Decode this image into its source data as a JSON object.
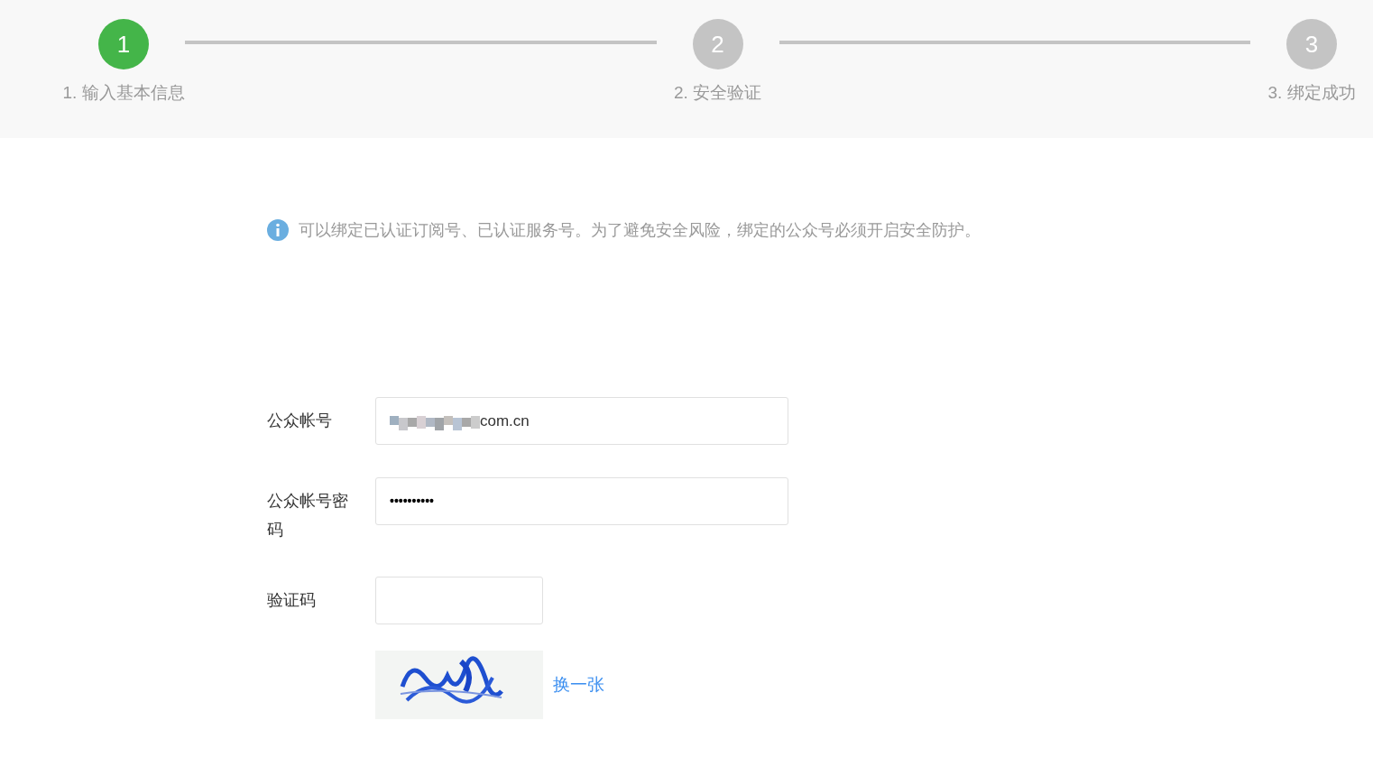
{
  "steps": [
    {
      "number": "1",
      "label": "1. 输入基本信息",
      "active": true
    },
    {
      "number": "2",
      "label": "2. 安全验证",
      "active": false
    },
    {
      "number": "3",
      "label": "3. 绑定成功",
      "active": false
    }
  ],
  "notice": "可以绑定已认证订阅号、已认证服务号。为了避免安全风险，绑定的公众号必须开启安全防护。",
  "form": {
    "fields": [
      {
        "kind": "text",
        "label": "公众帐号",
        "value": "com.cn",
        "redacted": true
      },
      {
        "kind": "password",
        "label": "公众帐号密码",
        "value": "••••••••••"
      },
      {
        "kind": "captcha",
        "label": "验证码"
      }
    ],
    "captcha": {
      "kind": "picture",
      "refresh_link": "换一张"
    }
  }
}
